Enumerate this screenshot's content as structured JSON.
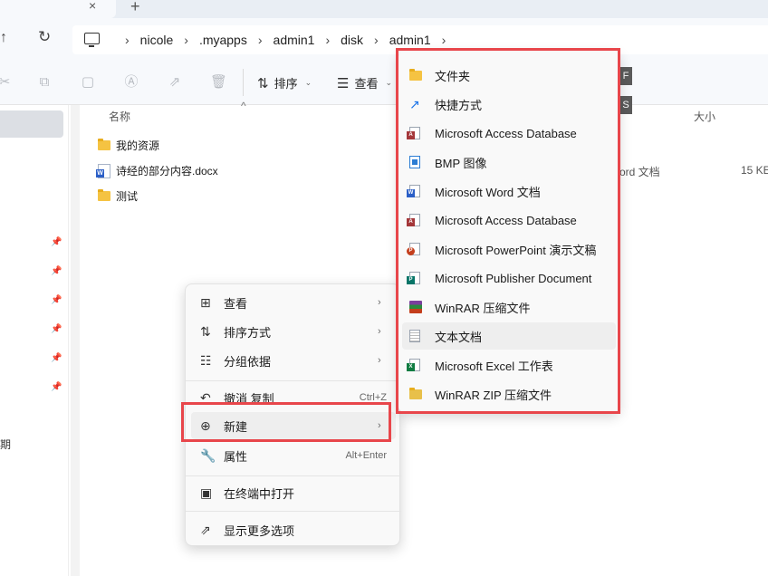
{
  "tabbar": {
    "close_glyph": "×",
    "new_tab_glyph": "+"
  },
  "nav": {
    "up_icon": "↑",
    "refresh_icon": "↻"
  },
  "breadcrumb": [
    "nicole",
    ".myapps",
    "admin1",
    "disk",
    "admin1"
  ],
  "toolbar": {
    "sort_label": "排序",
    "view_label": "查看",
    "chip1": "F",
    "chip2": "S"
  },
  "columns": {
    "name": "名称",
    "size": "大小"
  },
  "files": [
    {
      "name": "我的资源",
      "type": "folder"
    },
    {
      "name": "诗经的部分内容.docx",
      "type": "word",
      "kind": "ord 文档",
      "size": "15 KE"
    },
    {
      "name": "测试",
      "type": "folder"
    }
  ],
  "nav_partial_text": "期",
  "context_menu": {
    "items": [
      {
        "label": "查看",
        "icon": "grid-icon",
        "has_submenu": true
      },
      {
        "label": "排序方式",
        "icon": "sort-icon",
        "has_submenu": true
      },
      {
        "label": "分组依据",
        "icon": "group-icon",
        "has_submenu": true
      },
      {
        "label": "撤消 复制",
        "icon": "undo-icon",
        "shortcut": "Ctrl+Z"
      },
      {
        "label": "新建",
        "icon": "new-icon",
        "has_submenu": true
      },
      {
        "label": "属性",
        "icon": "wrench-icon",
        "shortcut": "Alt+Enter"
      },
      {
        "label": "在终端中打开",
        "icon": "terminal-icon"
      },
      {
        "label": "显示更多选项",
        "icon": "share-icon"
      }
    ]
  },
  "new_submenu": {
    "items": [
      {
        "label": "文件夹",
        "icon": "folder-icon",
        "color": "#f5c342"
      },
      {
        "label": "快捷方式",
        "icon": "shortcut-arrow-icon",
        "color": "#1a73e8"
      },
      {
        "label": "Microsoft Access Database",
        "icon": "access-icon",
        "color": "#a4373a"
      },
      {
        "label": "BMP 图像",
        "icon": "bmp-icon",
        "color": "#2b7cd3"
      },
      {
        "label": "Microsoft Word 文档",
        "icon": "word-icon",
        "color": "#2b5fc7"
      },
      {
        "label": "Microsoft Access Database",
        "icon": "access-icon",
        "color": "#a4373a"
      },
      {
        "label": "Microsoft PowerPoint 演示文稿",
        "icon": "powerpoint-icon",
        "color": "#c43e1c"
      },
      {
        "label": "Microsoft Publisher Document",
        "icon": "publisher-icon",
        "color": "#077568"
      },
      {
        "label": "WinRAR 压缩文件",
        "icon": "winrar-icon",
        "color": "#7a3f9d"
      },
      {
        "label": "文本文档",
        "icon": "text-doc-icon",
        "color": "#8a8a8a"
      },
      {
        "label": "Microsoft Excel 工作表",
        "icon": "excel-icon",
        "color": "#107c41"
      },
      {
        "label": "WinRAR ZIP 压缩文件",
        "icon": "zip-icon",
        "color": "#e8c04a"
      }
    ]
  },
  "colors": {
    "annotation_red": "#e8464b",
    "folder_yellow": "#f5c342"
  }
}
